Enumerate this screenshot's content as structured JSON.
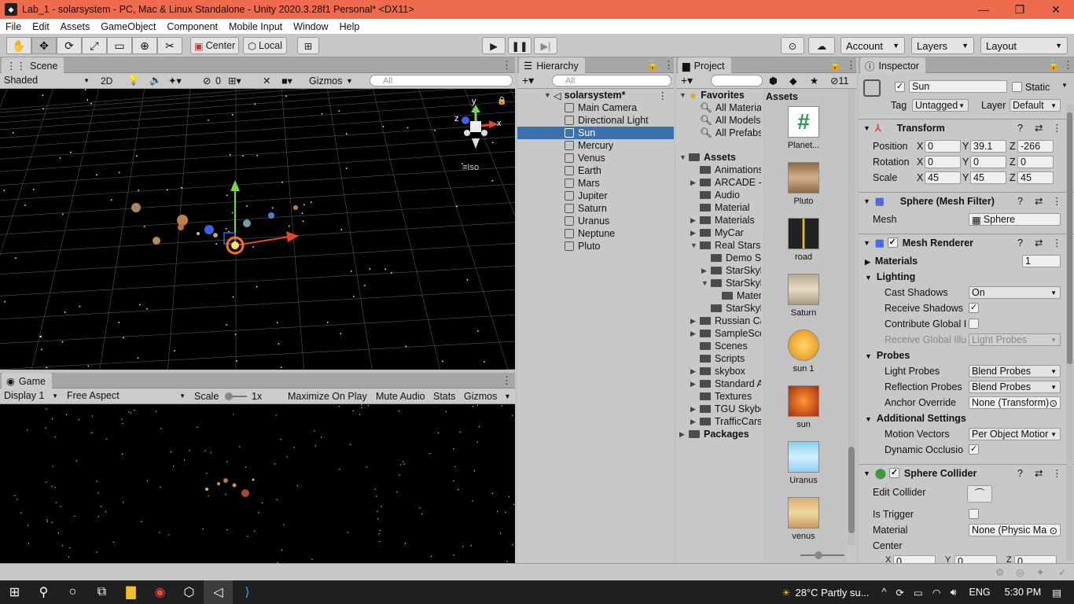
{
  "window": {
    "title": "Lab_1 - solarsystem - PC, Mac & Linux Standalone - Unity 2020.3.28f1 Personal* <DX11>"
  },
  "menu": [
    "File",
    "Edit",
    "Assets",
    "GameObject",
    "Component",
    "Mobile Input",
    "Window",
    "Help"
  ],
  "toolbar": {
    "center": "Center",
    "local": "Local",
    "account": "Account",
    "layers": "Layers",
    "layout": "Layout"
  },
  "scene": {
    "tab": "Scene",
    "shading": "Shaded",
    "mode2d": "2D",
    "hidden_count": "0",
    "gizmos": "Gizmos",
    "search_placeholder": "All",
    "iso": "Iso",
    "axis_y": "y",
    "axis_x": "x",
    "axis_z": "z"
  },
  "game": {
    "tab": "Game",
    "display": "Display 1",
    "aspect": "Free Aspect",
    "scale_label": "Scale",
    "scale_value": "1x",
    "maximize": "Maximize On Play",
    "mute": "Mute Audio",
    "stats": "Stats",
    "gizmos": "Gizmos"
  },
  "hierarchy": {
    "tab": "Hierarchy",
    "search_placeholder": "All",
    "scene_name": "solarsystem*",
    "items": [
      "Main Camera",
      "Directional Light",
      "Sun",
      "Mercury",
      "Venus",
      "Earth",
      "Mars",
      "Jupiter",
      "Saturn",
      "Uranus",
      "Neptune",
      "Pluto"
    ],
    "selected": "Sun"
  },
  "project": {
    "tab": "Project",
    "hidden_count": "11",
    "favorites": {
      "label": "Favorites",
      "items": [
        "All Materia",
        "All Models",
        "All Prefabs"
      ]
    },
    "assets_label": "Assets",
    "folders": [
      "Animations",
      "ARCADE -",
      "Audio",
      "Material",
      "Materials",
      "MyCar",
      "Real Stars",
      "Demo Sc",
      "StarSkyl",
      "StarSkyl",
      "Mater",
      "StarSkyl",
      "Russian Ca",
      "SampleSce",
      "Scenes",
      "Scripts",
      "skybox",
      "Standard A",
      "Textures",
      "TGU Skybo",
      "TrafficCars"
    ],
    "packages_label": "Packages",
    "grid_header": "Assets",
    "grid_items": [
      "Planet...",
      "Pluto",
      "road",
      "Saturn",
      "sun 1",
      "sun",
      "Uranus",
      "venus"
    ]
  },
  "inspector": {
    "tab": "Inspector",
    "object_name": "Sun",
    "static_label": "Static",
    "tag_label": "Tag",
    "tag_value": "Untagged",
    "layer_label": "Layer",
    "layer_value": "Default",
    "transform": {
      "title": "Transform",
      "position_label": "Position",
      "rotation_label": "Rotation",
      "scale_label": "Scale",
      "position": {
        "x": "0",
        "y": "39.1",
        "z": "-266"
      },
      "rotation": {
        "x": "0",
        "y": "0",
        "z": "0"
      },
      "scale": {
        "x": "45",
        "y": "45",
        "z": "45"
      }
    },
    "mesh_filter": {
      "title": "Sphere (Mesh Filter)",
      "mesh_label": "Mesh",
      "mesh_value": "Sphere"
    },
    "mesh_renderer": {
      "title": "Mesh Renderer",
      "materials_label": "Materials",
      "materials_count": "1",
      "lighting_label": "Lighting",
      "cast_shadows_label": "Cast Shadows",
      "cast_shadows_value": "On",
      "receive_shadows_label": "Receive Shadows",
      "contribute_gi_label": "Contribute Global I",
      "receive_gi_label": "Receive Global Illu",
      "receive_gi_value": "Light Probes",
      "probes_label": "Probes",
      "light_probes_label": "Light Probes",
      "light_probes_value": "Blend Probes",
      "reflection_probes_label": "Reflection Probes",
      "reflection_probes_value": "Blend Probes",
      "anchor_override_label": "Anchor Override",
      "anchor_override_value": "None (Transform)",
      "additional_label": "Additional Settings",
      "motion_vectors_label": "Motion Vectors",
      "motion_vectors_value": "Per Object Motior",
      "dynamic_occlusion_label": "Dynamic Occlusio"
    },
    "sphere_collider": {
      "title": "Sphere Collider",
      "edit_collider_label": "Edit Collider",
      "is_trigger_label": "Is Trigger",
      "material_label": "Material",
      "material_value": "None (Physic Ma",
      "center_label": "Center",
      "center_x": "0",
      "center_y": "0",
      "center_z": "0"
    }
  },
  "taskbar": {
    "weather": "28°C  Partly su...",
    "lang": "ENG",
    "time": "5:30 PM"
  },
  "colors": {
    "titlebar": "#ee6c4d",
    "selection": "#3a72b0",
    "x_axis": "#e2462b",
    "y_axis": "#7cd64a",
    "z_axis": "#3b62e6"
  }
}
